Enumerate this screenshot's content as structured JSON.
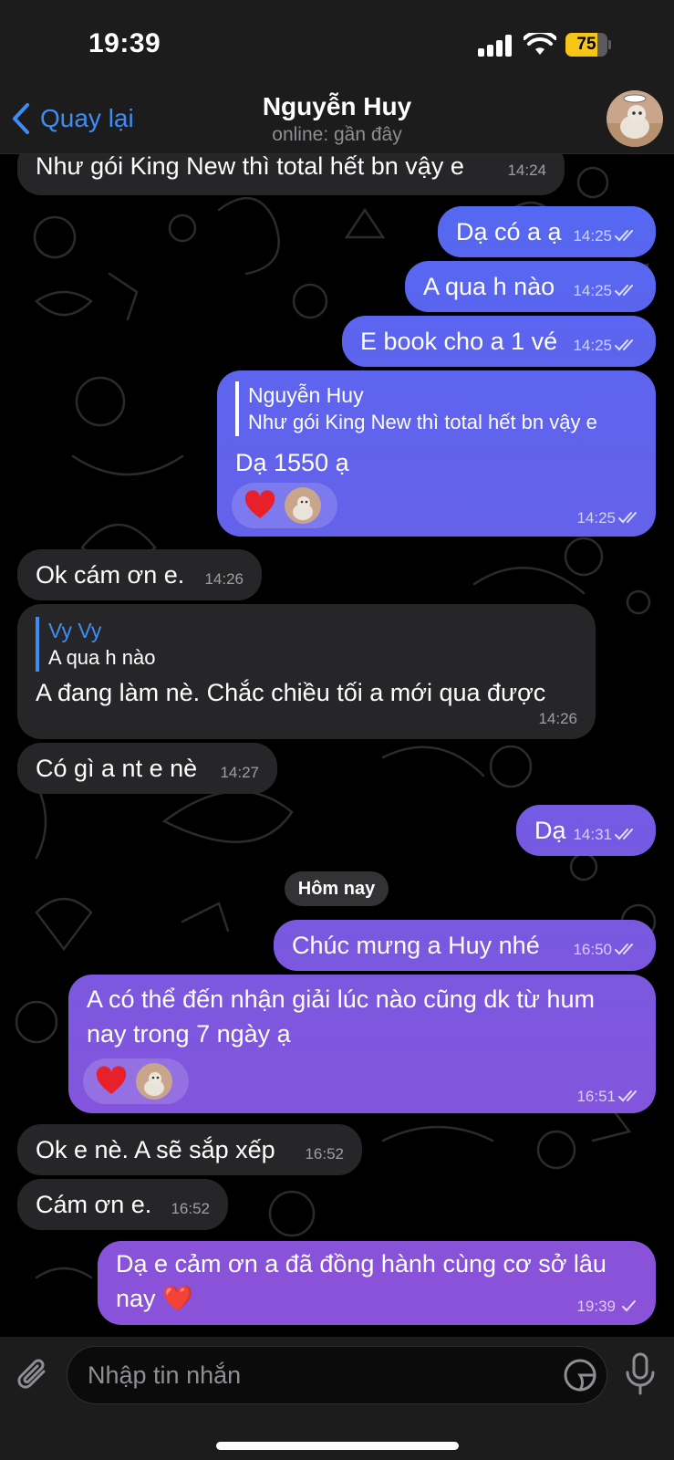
{
  "status_bar": {
    "time": "19:39",
    "battery": "75",
    "battery_level": 0.75
  },
  "header": {
    "back_label": "Quay lại",
    "contact_name": "Nguyễn Huy",
    "contact_status": "online: gần đây"
  },
  "colors": {
    "accent": "#3e8df5",
    "incoming_bubble": "#262628",
    "outgoing_top": "#5468f2",
    "outgoing_bottom": "#8a52d8",
    "reaction_heart": "#e8202a"
  },
  "messages": [
    {
      "dir": "in",
      "text": "Như gói King New thì total hết bn vậy e",
      "time": "14:24"
    },
    {
      "dir": "out",
      "text": "Dạ có a ạ",
      "time": "14:25",
      "status": "read"
    },
    {
      "dir": "out",
      "text": "A qua h nào",
      "time": "14:25",
      "status": "read"
    },
    {
      "dir": "out",
      "text": "E book cho a 1 vé",
      "time": "14:25",
      "status": "read"
    },
    {
      "dir": "out",
      "reply": {
        "name": "Nguyễn Huy",
        "text": "Như gói King New thì total hết bn vậy e"
      },
      "text": "Dạ 1550 ạ",
      "time": "14:25",
      "status": "read",
      "reaction": "heart"
    },
    {
      "dir": "in",
      "text": "Ok cám ơn e.",
      "time": "14:26"
    },
    {
      "dir": "in",
      "reply": {
        "name": "Vy Vy",
        "text": "A qua h nào"
      },
      "text": "A đang làm nè. Chắc chiều tối a mới qua được",
      "time": "14:26"
    },
    {
      "dir": "in",
      "text": "Có gì a nt e nè",
      "time": "14:27"
    },
    {
      "dir": "out",
      "text": "Dạ",
      "time": "14:31",
      "status": "read"
    },
    {
      "dir": "out",
      "text": "Chúc mưng a Huy nhé",
      "time": "16:50",
      "status": "read"
    },
    {
      "dir": "out",
      "lines": [
        "A có thể đến nhận giải lúc nào cũng dk từ hum",
        "nay trong 7 ngày ạ"
      ],
      "time": "16:51",
      "status": "read",
      "reaction": "heart"
    },
    {
      "dir": "in",
      "text": "Ok e nè. A sẽ sắp xếp",
      "time": "16:52"
    },
    {
      "dir": "in",
      "text": "Cám ơn e.",
      "time": "16:52"
    },
    {
      "dir": "out",
      "lines": [
        "Dạ e cảm ơn a đã đồng hành cùng cơ sở lâu",
        "nay ❤️"
      ],
      "time": "19:39",
      "status": "sent"
    }
  ],
  "date_separator": "Hôm nay",
  "composer": {
    "placeholder": "Nhập tin nhắn"
  }
}
